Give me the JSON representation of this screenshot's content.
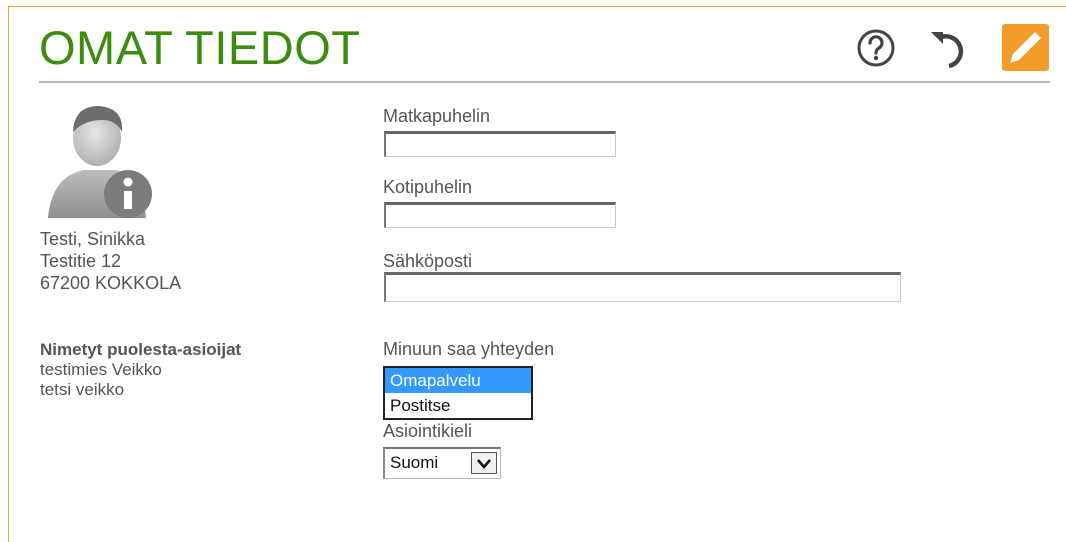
{
  "header": {
    "title": "OMAT TIEDOT",
    "icons": {
      "help": "help-icon",
      "undo": "undo-icon",
      "edit": "pencil-icon"
    },
    "colors": {
      "title": "#3d8b0f",
      "accent": "#f39c2a"
    }
  },
  "person": {
    "name": "Testi, Sinikka",
    "street": "Testitie 12",
    "postal": "67200 KOKKOLA"
  },
  "proxies": {
    "title": "Nimetyt puolesta-asioijat",
    "items": [
      "testimies Veikko",
      "tetsi veikko"
    ]
  },
  "form": {
    "mobile_label": "Matkapuhelin",
    "mobile_value": "",
    "home_phone_label": "Kotipuhelin",
    "home_phone_value": "",
    "email_label": "Sähköposti",
    "email_value": "",
    "contact_label": "Minuun saa yhteyden",
    "contact_options": [
      "Omapalvelu",
      "Postitse"
    ],
    "contact_selected": "Omapalvelu",
    "language_label": "Asiointikieli",
    "language_value": "Suomi"
  }
}
